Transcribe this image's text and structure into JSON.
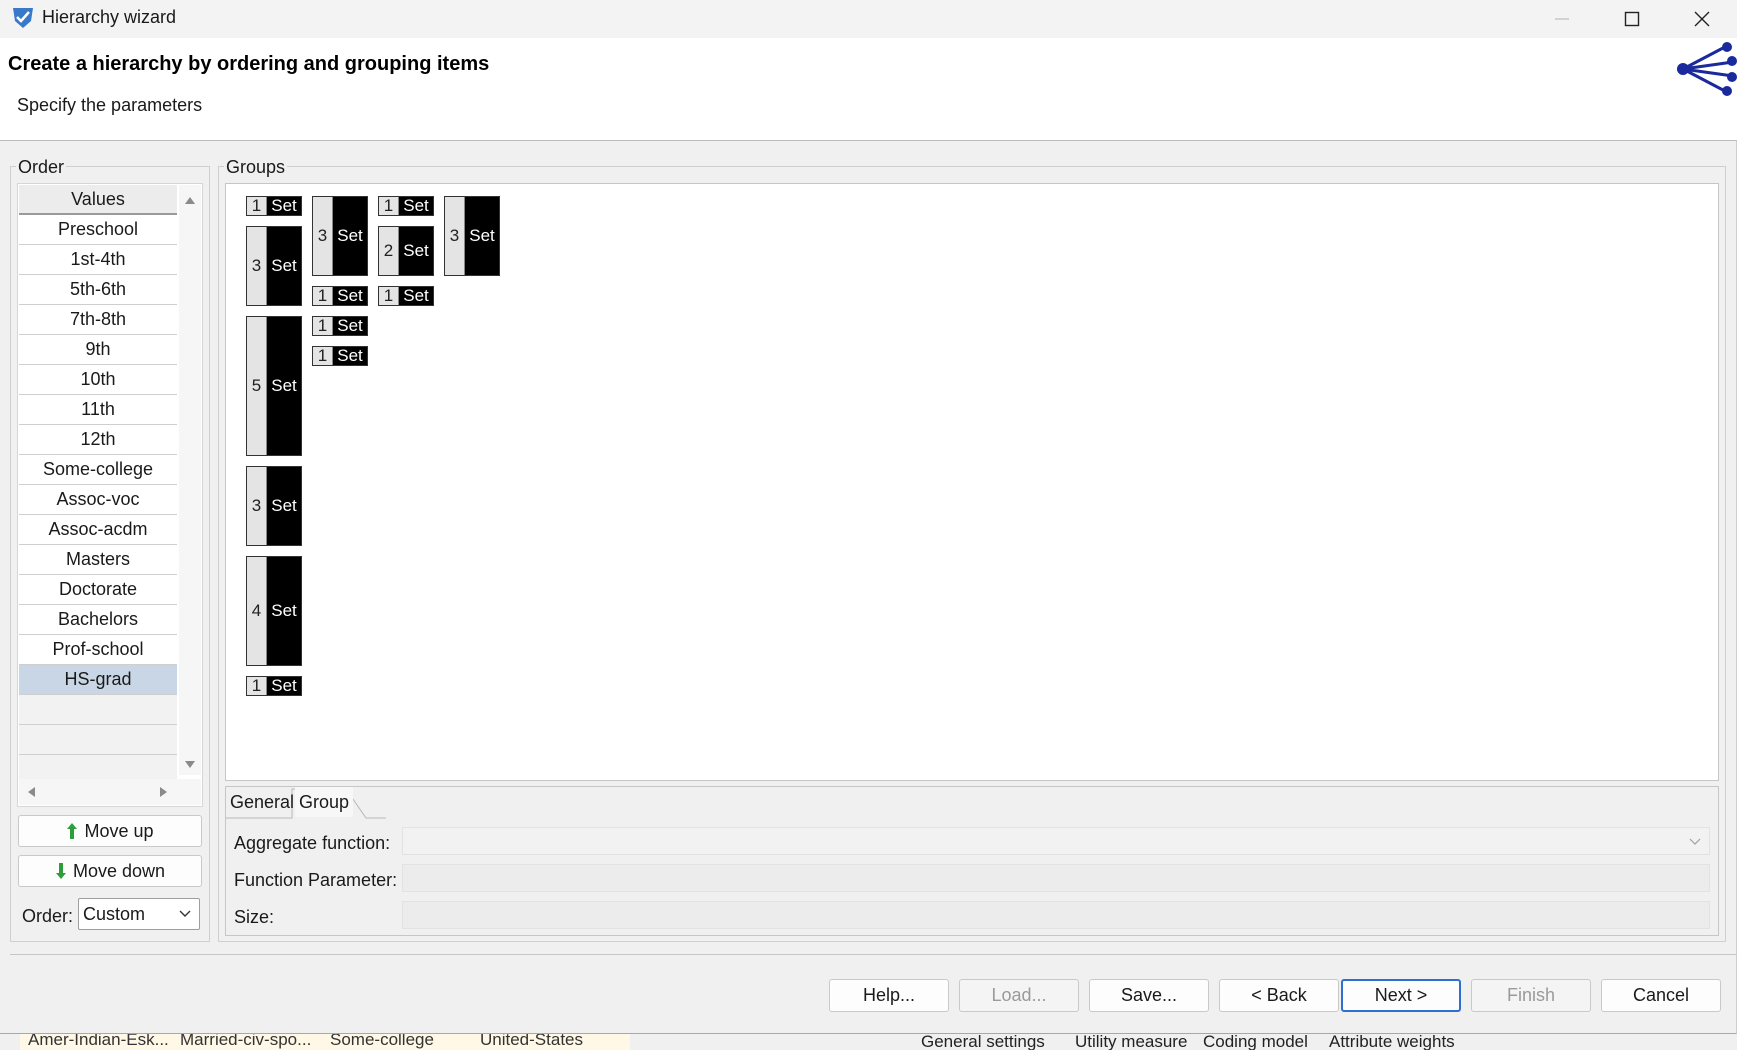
{
  "window": {
    "title": "Hierarchy wizard"
  },
  "header": {
    "title": "Create a hierarchy by ordering and grouping items",
    "subtitle": "Specify the parameters"
  },
  "order_panel": {
    "label": "Order",
    "column_header": "Values",
    "items": [
      "Preschool",
      "1st-4th",
      "5th-6th",
      "7th-8th",
      "9th",
      "10th",
      "11th",
      "12th",
      "Some-college",
      "Assoc-voc",
      "Assoc-acdm",
      "Masters",
      "Doctorate",
      "Bachelors",
      "Prof-school",
      "HS-grad"
    ],
    "selected_item": "HS-grad",
    "move_up_label": "Move up",
    "move_down_label": "Move down",
    "order_label": "Order:",
    "order_value": "Custom"
  },
  "groups_panel": {
    "label": "Groups",
    "levels": [
      {
        "groups": [
          {
            "size": "1",
            "label": "Set"
          },
          {
            "size": "3",
            "label": "Set"
          },
          {
            "size": "5",
            "label": "Set"
          },
          {
            "size": "3",
            "label": "Set"
          },
          {
            "size": "4",
            "label": "Set"
          },
          {
            "size": "1",
            "label": "Set"
          }
        ]
      },
      {
        "groups": [
          {
            "size": "3",
            "label": "Set"
          },
          {
            "size": "1",
            "label": "Set"
          },
          {
            "size": "1",
            "label": "Set"
          },
          {
            "size": "1",
            "label": "Set"
          }
        ]
      },
      {
        "groups": [
          {
            "size": "1",
            "label": "Set"
          },
          {
            "size": "2",
            "label": "Set"
          },
          {
            "size": "1",
            "label": "Set"
          }
        ]
      },
      {
        "groups": [
          {
            "size": "3",
            "label": "Set"
          }
        ]
      }
    ]
  },
  "tabs": {
    "general": "General",
    "group": "Group",
    "active": "Group"
  },
  "group_fields": {
    "aggregate_label": "Aggregate function:",
    "aggregate_value": "",
    "parameter_label": "Function Parameter:",
    "parameter_value": "",
    "size_label": "Size:",
    "size_value": ""
  },
  "footer_buttons": {
    "help": "Help...",
    "load": "Load...",
    "save": "Save...",
    "back": "< Back",
    "next": "Next >",
    "finish": "Finish",
    "cancel": "Cancel"
  },
  "background": {
    "cells": [
      "Amer-Indian-Esk...",
      "Married-civ-spo...",
      "Some-college",
      "United-States"
    ],
    "tabs": [
      "General settings",
      "Utility measure",
      "Coding model",
      "Attribute weights"
    ]
  },
  "colors": {
    "accent": "#2f6fd1",
    "selection": "#c8d6e5",
    "group_fill": "#000000",
    "icon_blue": "#1a2a9c"
  },
  "icons": [
    "app-logo-icon",
    "minimize-icon",
    "maximize-icon",
    "close-icon",
    "hierarchy-tree-icon",
    "scroll-up-icon",
    "scroll-down-icon",
    "scroll-left-icon",
    "scroll-right-icon",
    "arrow-up-icon",
    "arrow-down-icon",
    "chevron-down-icon"
  ]
}
